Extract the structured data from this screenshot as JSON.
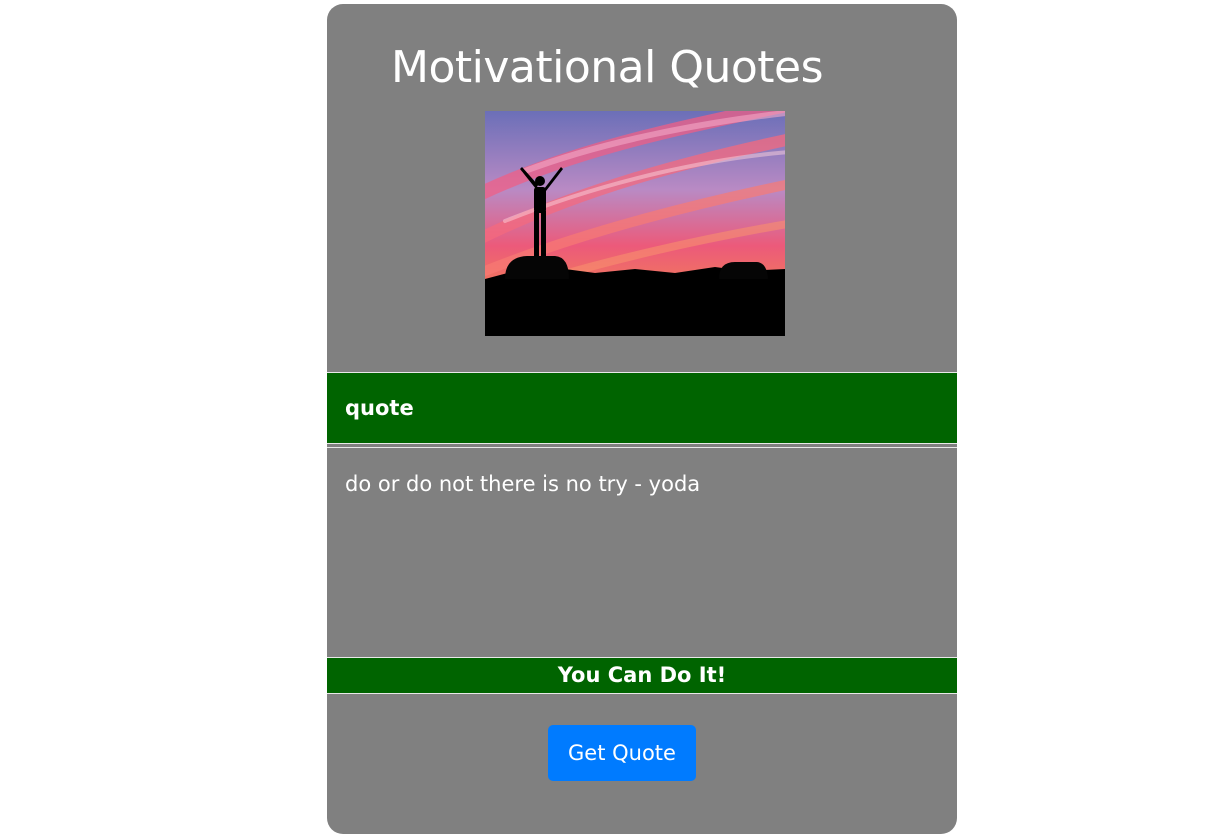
{
  "page": {
    "title": "Motivational Quotes"
  },
  "image": {
    "subject": "person-silhouette-arms-raised-at-sunset"
  },
  "quote_card": {
    "header_label": "quote",
    "quote_text": "do or do not there is no try - yoda",
    "footer_text": "You Can Do It!"
  },
  "actions": {
    "get_quote_label": "Get Quote"
  },
  "colors": {
    "card_background": "#808080",
    "banner_green": "#006400",
    "button_blue": "#007bff",
    "text": "#ffffff"
  }
}
